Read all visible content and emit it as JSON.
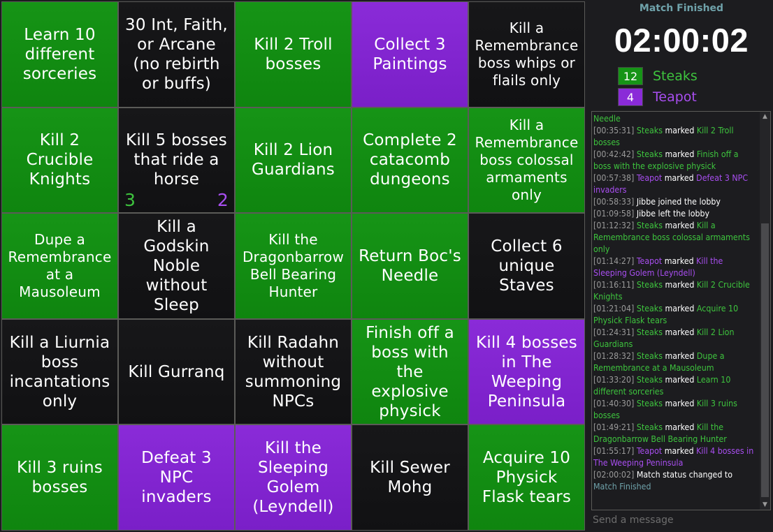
{
  "board": [
    {
      "text": "Learn 10 different sorceries",
      "state": "green"
    },
    {
      "text": "30 Int, Faith, or Arcane (no rebirth or buffs)",
      "state": "none"
    },
    {
      "text": "Kill 2 Troll bosses",
      "state": "green"
    },
    {
      "text": "Collect 3 Paintings",
      "state": "purple"
    },
    {
      "text": "Kill a Remembrance boss whips or flails only",
      "state": "none",
      "small": true
    },
    {
      "text": "Kill 2 Crucible Knights",
      "state": "green"
    },
    {
      "text": "Kill 5 bosses that ride a horse",
      "state": "none",
      "counts": [
        "3",
        "2"
      ]
    },
    {
      "text": "Kill 2 Lion Guardians",
      "state": "green"
    },
    {
      "text": "Complete 2 catacomb dungeons",
      "state": "green"
    },
    {
      "text": "Kill a Remembrance boss colossal armaments only",
      "state": "green",
      "small": true
    },
    {
      "text": "Dupe a Remembrance at a Mausoleum",
      "state": "green",
      "small": true
    },
    {
      "text": "Kill a Godskin Noble without Sleep",
      "state": "none"
    },
    {
      "text": "Kill the Dragonbarrow Bell Bearing Hunter",
      "state": "green",
      "small": true
    },
    {
      "text": "Return Boc's Needle",
      "state": "green"
    },
    {
      "text": "Collect 6 unique Staves",
      "state": "none"
    },
    {
      "text": "Kill a Liurnia boss incantations only",
      "state": "none"
    },
    {
      "text": "Kill Gurranq",
      "state": "none"
    },
    {
      "text": "Kill Radahn without summoning NPCs",
      "state": "none"
    },
    {
      "text": "Finish off a boss with the explosive physick",
      "state": "green"
    },
    {
      "text": "Kill 4 bosses in The Weeping Peninsula",
      "state": "purple"
    },
    {
      "text": "Kill 3 ruins bosses",
      "state": "green"
    },
    {
      "text": "Defeat 3 NPC invaders",
      "state": "purple"
    },
    {
      "text": "Kill the Sleeping Golem (Leyndell)",
      "state": "purple"
    },
    {
      "text": "Kill Sewer Mohg",
      "state": "none"
    },
    {
      "text": "Acquire 10 Physick Flask tears",
      "state": "green"
    }
  ],
  "status": "Match Finished",
  "timer": "02:00:02",
  "teams": [
    {
      "score": "12",
      "name": "Steaks",
      "color": "#169416"
    },
    {
      "score": "4",
      "name": "Teapot",
      "color": "#8a2bd8"
    }
  ],
  "chat": [
    {
      "type": "frag",
      "goal": "Needle",
      "team": "green"
    },
    {
      "type": "mark",
      "time": "[00:35:31]",
      "player": "Steaks",
      "team": "green",
      "goal": "Kill 2 Troll bosses"
    },
    {
      "type": "mark",
      "time": "[00:42:42]",
      "player": "Steaks",
      "team": "green",
      "goal": "Finish off a boss with the explosive physick"
    },
    {
      "type": "mark",
      "time": "[00:57:38]",
      "player": "Teapot",
      "team": "purple",
      "goal": "Defeat 3 NPC invaders"
    },
    {
      "type": "sys",
      "time": "[00:58:33]",
      "text": "Jibbe joined the lobby"
    },
    {
      "type": "sys",
      "time": "[01:09:58]",
      "text": "Jibbe left the lobby"
    },
    {
      "type": "mark",
      "time": "[01:12:32]",
      "player": "Steaks",
      "team": "green",
      "goal": "Kill a Remembrance boss colossal armaments only"
    },
    {
      "type": "mark",
      "time": "[01:14:27]",
      "player": "Teapot",
      "team": "purple",
      "goal": "Kill the Sleeping Golem (Leyndell)"
    },
    {
      "type": "mark",
      "time": "[01:16:11]",
      "player": "Steaks",
      "team": "green",
      "goal": "Kill 2 Crucible Knights"
    },
    {
      "type": "mark",
      "time": "[01:21:04]",
      "player": "Steaks",
      "team": "green",
      "goal": "Acquire 10 Physick Flask tears"
    },
    {
      "type": "mark",
      "time": "[01:24:31]",
      "player": "Steaks",
      "team": "green",
      "goal": "Kill 2 Lion Guardians"
    },
    {
      "type": "mark",
      "time": "[01:28:32]",
      "player": "Steaks",
      "team": "green",
      "goal": "Dupe a Remembrance at a Mausoleum"
    },
    {
      "type": "mark",
      "time": "[01:33:20]",
      "player": "Steaks",
      "team": "green",
      "goal": "Learn 10 different sorceries"
    },
    {
      "type": "mark",
      "time": "[01:40:30]",
      "player": "Steaks",
      "team": "green",
      "goal": "Kill 3 ruins bosses"
    },
    {
      "type": "mark",
      "time": "[01:49:21]",
      "player": "Steaks",
      "team": "green",
      "goal": "Kill the Dragonbarrow Bell Bearing Hunter"
    },
    {
      "type": "mark",
      "time": "[01:55:17]",
      "player": "Teapot",
      "team": "purple",
      "goal": "Kill 4 bosses in The Weeping Peninsula"
    },
    {
      "type": "status",
      "time": "[02:00:02]",
      "text": "Match status changed to",
      "value": "Match Finished"
    }
  ],
  "chat_marked_word": "marked",
  "message_placeholder": "Send a message"
}
